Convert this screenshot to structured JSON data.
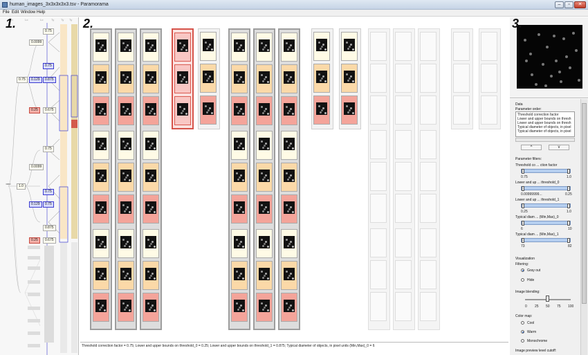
{
  "window": {
    "title": "human_images_3x3x3x3x3.tsv - Paramorama",
    "buttons": [
      "–",
      "▫",
      "✕"
    ]
  },
  "menu": [
    "File",
    "Edit",
    "Window",
    "Help"
  ],
  "annotations": [
    "1.",
    "2.",
    "3."
  ],
  "tree": {
    "header": [
      "Th",
      "Lo",
      "Lo",
      "Ty",
      "Ty",
      "Ty"
    ],
    "nodes": [
      "1.0",
      "0.75",
      "0.0099",
      "0.75",
      "0.75",
      "0.129",
      "0.875",
      "0.25",
      "0.675",
      "0.75",
      "0.0099",
      "0.75",
      "0.129",
      "0.75",
      "0.875",
      "0.25",
      "0.675"
    ]
  },
  "status": "Threshold correction factor = 0.75; Lower and upper bounds on threshold_0 = 0.25; Lower and upper bounds on threshold_1 = 0.875; Typical diameter of objects, in pixel units (Min,Max)_0 = 6",
  "panel": {
    "section_title": "Data",
    "order_label": "Parameter order:",
    "order_items": [
      "Threshold correction factor",
      "Lower and upper bounds on thresh",
      "Lower and upper bounds on thresh",
      "Typical diameter of objects, in pixel",
      "Typical diameter of objects, in pixel"
    ],
    "up_label": "^",
    "down_label": "v",
    "filters_label": "Parameter filters:",
    "filters": [
      {
        "name": "Threshold co ... ction factor",
        "min": "0.75",
        "max": "1.0"
      },
      {
        "name": "Lower and up ... threshold_0",
        "min": "0.00999999...",
        "max": "0.25"
      },
      {
        "name": "Lower and up ... threshold_1",
        "min": "0.25",
        "max": "1.0"
      },
      {
        "name": "Typical diam ... (Min,Max)_0",
        "min": "6",
        "max": "10"
      },
      {
        "name": "Typical diam ... (Min,Max)_1",
        "min": "73",
        "max": "82"
      }
    ],
    "viz_label": "Visualization",
    "filtering_label": "Filtering:",
    "filtering_options": [
      "Gray out",
      "Hide"
    ],
    "blend_label": "Image blending:",
    "blend_ticks": [
      "0",
      "25",
      "50",
      "75",
      "100"
    ],
    "colormap_label": "Color map:",
    "colormap_options": [
      "Cool",
      "Warm",
      "Monochrome"
    ],
    "cutoff_label": "Image preview level cutoff:"
  }
}
